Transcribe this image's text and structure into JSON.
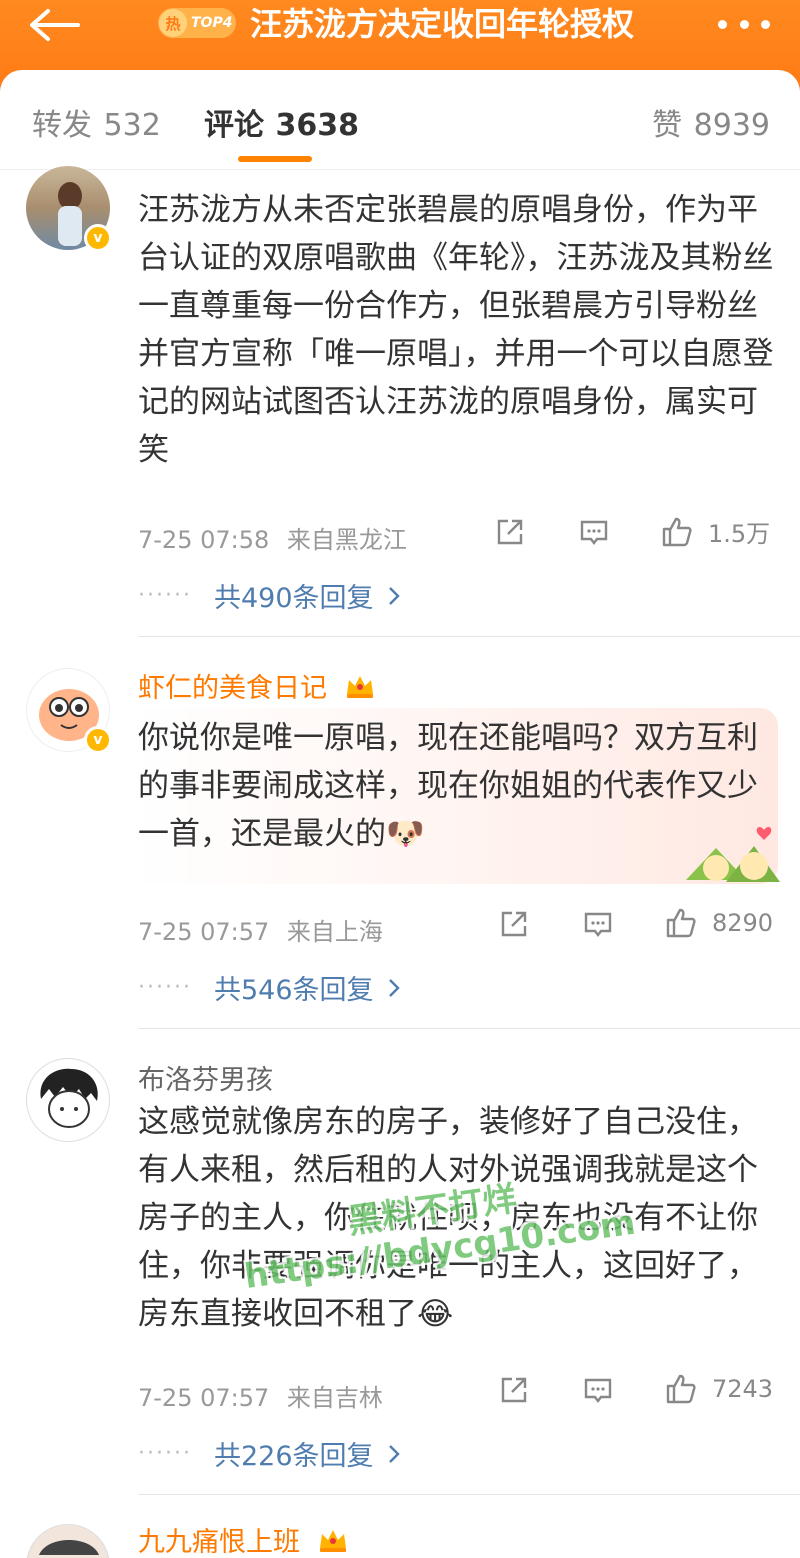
{
  "header": {
    "title": "汪苏泷方决定收回年轮授权",
    "hot_badge_char": "热",
    "hot_badge_rank": "TOP4",
    "accent": "#ff7a16"
  },
  "tabs": [
    {
      "label": "转发",
      "count": "532"
    },
    {
      "label": "评论",
      "count": "3638"
    },
    {
      "label": "赞",
      "count": "8939"
    }
  ],
  "comments": [
    {
      "username": "",
      "verified": true,
      "text": "汪苏泷方从未否定张碧晨的原唱身份，作为平台认证的双原唱歌曲《年轮》，汪苏泷及其粉丝一直尊重每一份合作方，但张碧晨方引导粉丝并官方宣称「唯一原唱」，并用一个可以自愿登记的网站试图否认汪苏泷的原唱身份，属实可笑",
      "time": "7-25 07:58",
      "location": "来自黑龙江",
      "likes": "1.5万",
      "replies": "共490条回复"
    },
    {
      "username": "虾仁的美食日记",
      "verified": true,
      "text": "你说你是唯一原唱，现在还能唱吗？双方互利的事非要闹成这样，现在你姐姐的代表作又少一首，还是最火的🐶",
      "time": "7-25 07:57",
      "location": "来自上海",
      "likes": "8290",
      "replies": "共546条回复"
    },
    {
      "username": "布洛芬男孩",
      "verified": false,
      "text": "这感觉就像房东的房子，装修好了自己没住，有人来租，然后租的人对外说强调我就是这个房子的主人，你住就住呗，房东也没有不让你住，你非要强调你是唯一的主人，这回好了，房东直接收回不租了😂",
      "time": "7-25 07:57",
      "location": "来自吉林",
      "likes": "7243",
      "replies": "共226条回复"
    },
    {
      "username": "九九痛恨上班",
      "verified": false
    }
  ],
  "watermark": {
    "line1": "黑料不打烊",
    "line2": "https://bdycg10.com"
  },
  "icons": {
    "back": "back-arrow-icon",
    "more": "more-dots-icon",
    "share": "share-icon",
    "comment": "comment-icon",
    "like": "thumbs-up-icon",
    "chevron": "chevron-right-icon",
    "crown": "crown-icon"
  }
}
